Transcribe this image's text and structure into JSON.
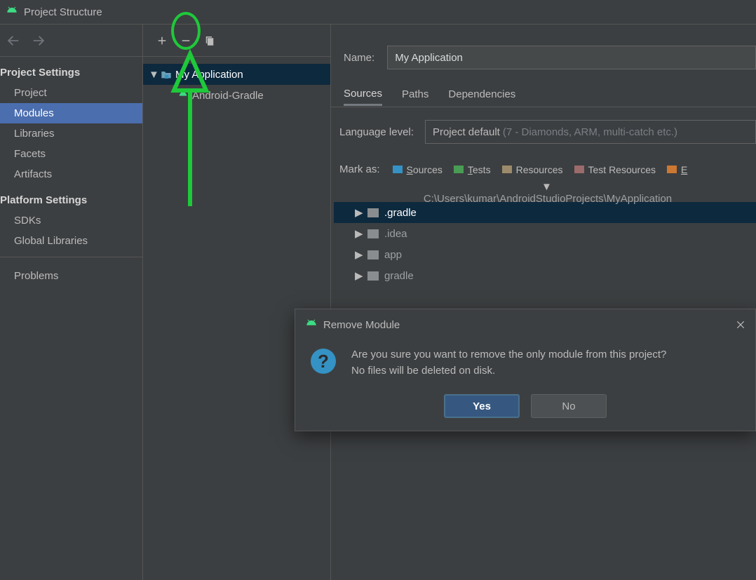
{
  "window": {
    "title": "Project Structure"
  },
  "sidebar": {
    "sections": [
      {
        "label": "Project Settings",
        "items": [
          "Project",
          "Modules",
          "Libraries",
          "Facets",
          "Artifacts"
        ],
        "selected": 1
      },
      {
        "label": "Platform Settings",
        "items": [
          "SDKs",
          "Global Libraries"
        ]
      }
    ],
    "bottom": {
      "items": [
        "Problems"
      ]
    }
  },
  "modules": {
    "root": "My Application",
    "children": [
      "Android-Gradle"
    ]
  },
  "right": {
    "name_label": "Name:",
    "name_value": "My Application",
    "tabs": [
      "Sources",
      "Paths",
      "Dependencies"
    ],
    "active_tab": 0,
    "lang_label": "Language level:",
    "lang_value": "Project default",
    "lang_hint": "(7 - Diamonds, ARM, multi-catch etc.)",
    "mark_as": "Mark as:",
    "marks": [
      {
        "label": "Sources",
        "color": "#3592c4",
        "key": "S"
      },
      {
        "label": "Tests",
        "color": "#499c54",
        "key": "T"
      },
      {
        "label": "Resources",
        "color": "#9c8b6b",
        "key": ""
      },
      {
        "label": "Test Resources",
        "color": "#9c6b6b",
        "key": ""
      },
      {
        "label": "E",
        "color": "#cc7832",
        "key": ""
      }
    ],
    "tree": {
      "root": "C:\\Users\\kumar\\AndroidStudioProjects\\MyApplication",
      "children": [
        ".gradle",
        ".idea",
        "app",
        "gradle"
      ],
      "selected": 0
    }
  },
  "dialog": {
    "title": "Remove Module",
    "message_line1": "Are you sure you want to remove the only module from this project?",
    "message_line2": "No files will be deleted on disk.",
    "yes": "Yes",
    "no": "No"
  }
}
